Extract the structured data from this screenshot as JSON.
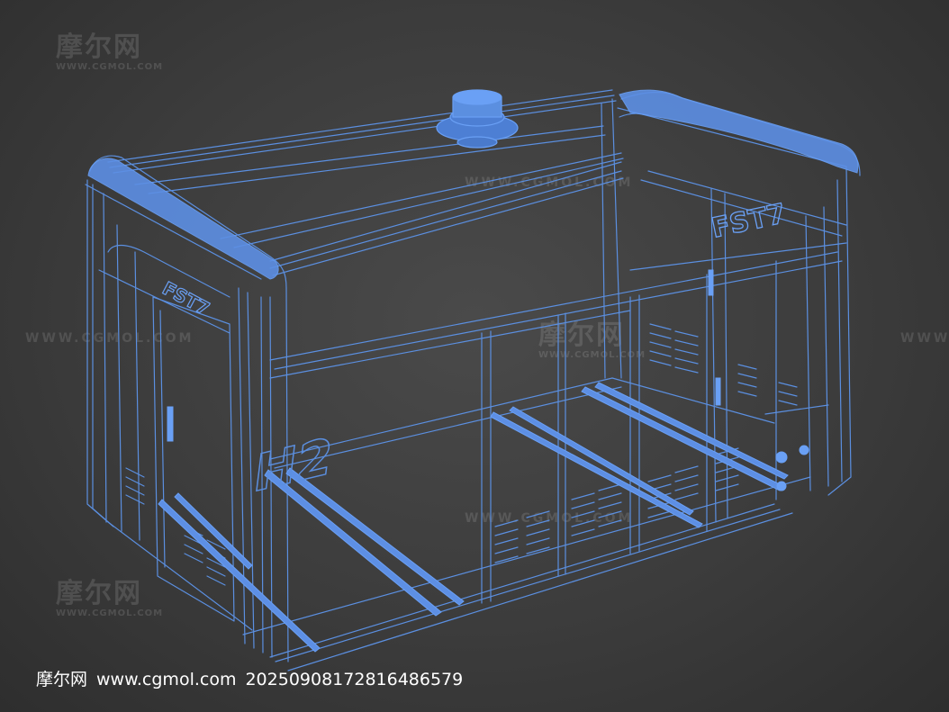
{
  "watermark": {
    "brand": "摩尔网",
    "domain": "WWW.CGMOL.COM",
    "domain_line": "WWW.CGMOL.COM"
  },
  "model_labels": {
    "front_logo": "H2",
    "side_logo": "FST7",
    "top_logo": "FST7"
  },
  "caption": {
    "site": "摩尔网",
    "url": "www.cgmol.com",
    "id": "20250908172816486579"
  },
  "colors": {
    "wire": "#5b8fe0",
    "wire_bright": "#6aa0f5",
    "background": "#404040",
    "caption": "#ffffff"
  }
}
